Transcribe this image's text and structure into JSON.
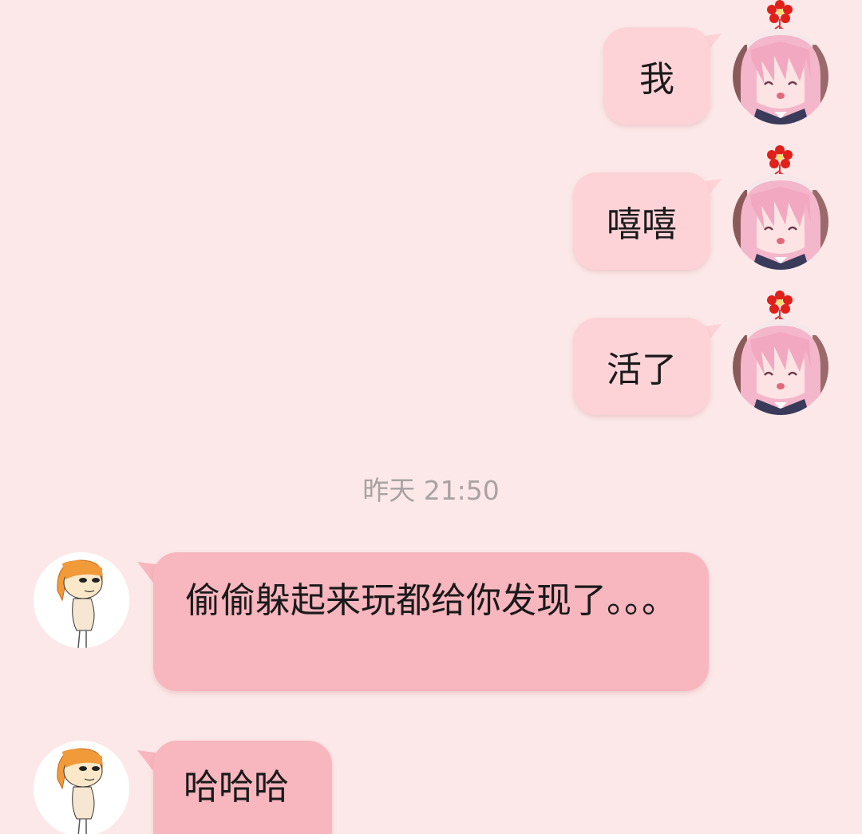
{
  "messages_out": [
    {
      "text": "我"
    },
    {
      "text": "嘻嘻"
    },
    {
      "text": "活了"
    }
  ],
  "timestamp": "昨天 21:50",
  "messages_in": [
    {
      "text": "偷偷躲起来玩都给你发现了。。。"
    },
    {
      "text": "哈哈哈"
    }
  ],
  "colors": {
    "background": "#fce8e8",
    "bubble_out": "#fdd3d8",
    "bubble_in": "#f8b6bf",
    "timestamp_text": "#a9a2a2"
  },
  "icons": {
    "my_avatar": "anime-girl-avatar-icon",
    "my_badge": "red-flower-icon",
    "peer_avatar": "cartoon-kid-avatar-icon"
  }
}
